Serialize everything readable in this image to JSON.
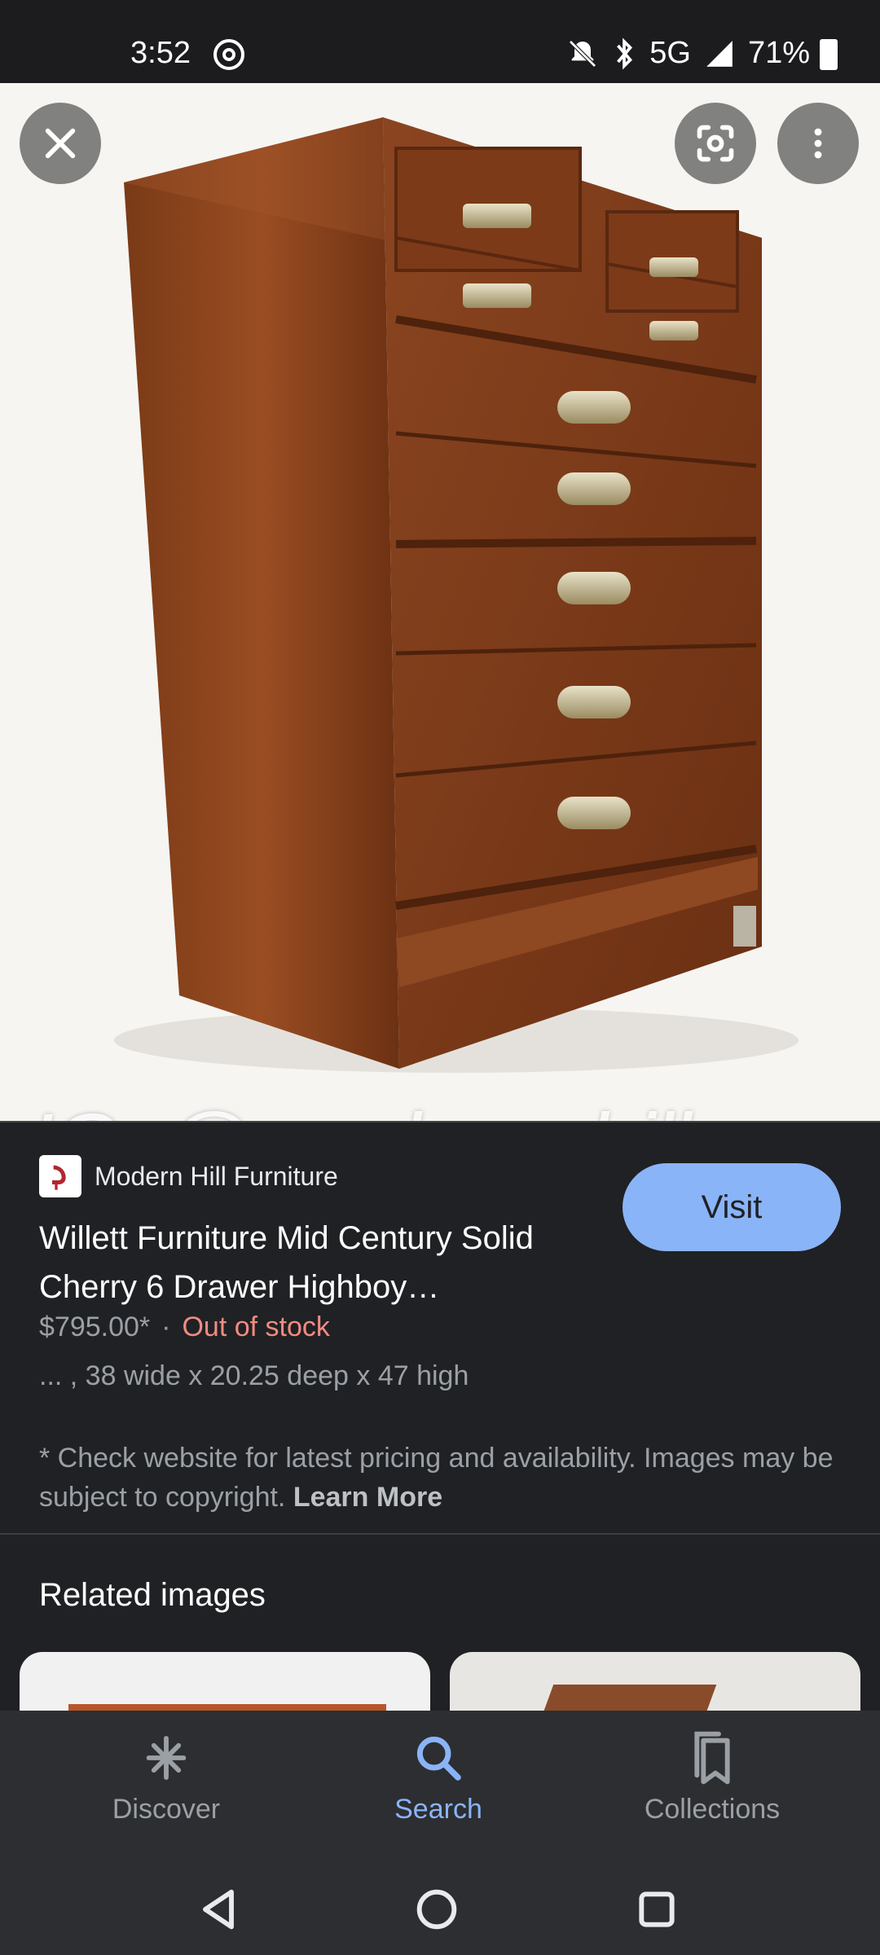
{
  "status_bar": {
    "time": "3:52",
    "network": "5G",
    "battery": "71%"
  },
  "image": {
    "watermark": "IG: @modern_hill_"
  },
  "result": {
    "source": "Modern Hill Furniture",
    "visit_label": "Visit",
    "title": "Willett Furniture Mid Century Solid Cherry 6 Drawer Highboy…",
    "price": "$795.00*",
    "separator": "·",
    "stock": "Out of stock",
    "dimensions": "... , 38 wide x 20.25 deep x 47 high",
    "disclaimer": "* Check website for latest pricing and availability. Images may be subject to copyright.",
    "learn_more": "Learn More"
  },
  "related": {
    "title": "Related images"
  },
  "bottom_nav": {
    "discover": "Discover",
    "search": "Search",
    "collections": "Collections"
  },
  "colors": {
    "accent": "#8ab4f8",
    "out_of_stock": "#f28b82",
    "background": "#202124"
  }
}
